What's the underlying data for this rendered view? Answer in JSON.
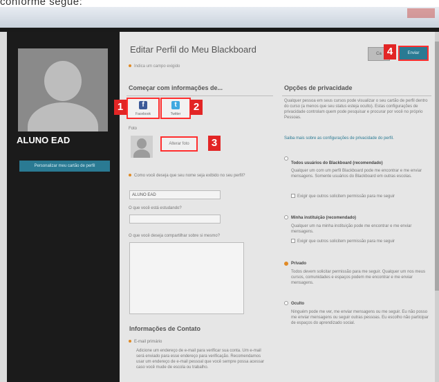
{
  "caption": "conforme segue:",
  "user": {
    "name": "ALUNO EAD",
    "customize_button": "Personalizar meu cartão de perfil"
  },
  "header": {
    "title": "Editar Perfil do Meu Blackboard",
    "required_hint": "Indica um campo exigido",
    "cancel_label": "Ca",
    "send_label": "Enviar"
  },
  "callouts": [
    "1",
    "2",
    "3",
    "4"
  ],
  "left": {
    "section_title": "Começar com informações de...",
    "facebook": {
      "icon": "f",
      "label": "Facebook"
    },
    "twitter": {
      "icon": "t",
      "label": "Twitter"
    },
    "photo_label": "Foto",
    "edit_photo": "Alterar foto",
    "name_question": "Como você deseja que seu nome seja exibido no seu perfil?",
    "name_value": "ALUNO EAD",
    "studying_label": "O que você está estudando?",
    "share_label": "O que você deseja compartilhar sobre si mesmo?",
    "contact_title": "Informações de Contato",
    "email_label": "E-mail primário",
    "email_help": "Adicione um endereço de e-mail para verificar sua conta. Um e-mail será enviado para esse endereço para verificação. Recomendamos usar um endereço de e-mail pessoal que você sempre possa acessar caso você mude de escola ou trabalho."
  },
  "privacy": {
    "title": "Opções de privacidade",
    "intro": "Qualquer pessoa em seus cursos pode visualizar o seu cartão de perfil dentro do curso (a menos que seu status esteja oculto). Estas configurações de privacidade controlam quem pode pesquisar e procurar por você no próprio Pessoas.",
    "link": "Saiba mais sobre as configurações de privacidade do perfil.",
    "options": [
      {
        "title": "Todos usuários do Blackboard (recomendado)",
        "desc": "Qualquer um com um perfil Blackboard pode me encontrar e me enviar mensagens. Somente usuários do Blackboard em outras escolas.",
        "check": "Exigir que outros solicitem permissão para me seguir",
        "selected": false
      },
      {
        "title": "Minha instituição (recomendado)",
        "desc": "Qualquer um na minha instituição pode me encontrar e me enviar mensagens.",
        "check": "Exigir que outros solicitem permissão para me seguir",
        "selected": false
      },
      {
        "title": "Privado",
        "desc": "Todos devem solicitar permissão para me seguir. Qualquer um nos meus cursos, comunidades e espaços podem me encontrar e me enviar mensagens.",
        "check": "",
        "selected": true
      },
      {
        "title": "Oculto",
        "desc": "Ninguém pode me ver, me enviar mensagens ou me seguir. Eu não posso me enviar mensagens ou seguir outras pessoas. Eu escolho não participar de espaços do aprendizado social.",
        "check": "",
        "selected": false
      }
    ]
  },
  "colors": {
    "accent": "#2a7a93",
    "callout": "#e22525",
    "required": "#e08a26",
    "sidebar": "#1b1b1b"
  }
}
